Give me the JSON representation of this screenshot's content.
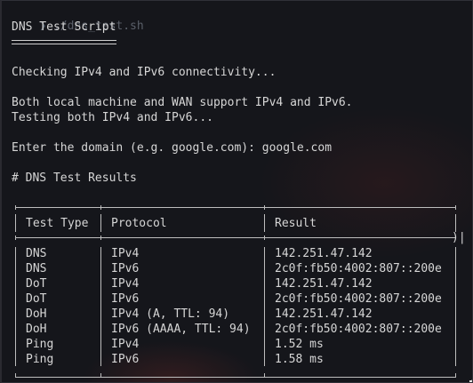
{
  "prompt": {
    "symbol": "❯",
    "command": "./dns_test.sh"
  },
  "heading": "DNS Test Script",
  "messages": {
    "checking": "Checking IPv4 and IPv6 connectivity...",
    "support": "Both local machine and WAN support IPv4 and IPv6.",
    "testing": "Testing both IPv4 and IPv6...",
    "enter_domain": "Enter the domain (e.g. google.com): google.com",
    "results_heading": "# DNS Test Results"
  },
  "table": {
    "headers": [
      "Test Type",
      "Protocol",
      "Result"
    ],
    "rows": [
      [
        "DNS",
        "IPv4",
        "142.251.47.142"
      ],
      [
        "DNS",
        "IPv6",
        "2c0f:fb50:4002:807::200e"
      ],
      [
        "DoT",
        "IPv4",
        "142.251.47.142"
      ],
      [
        "DoT",
        "IPv6",
        "2c0f:fb50:4002:807::200e"
      ],
      [
        "DoH",
        "IPv4 (A, TTL: 94)",
        "142.251.47.142"
      ],
      [
        "DoH",
        "IPv6 (AAAA, TTL: 94)",
        "2c0f:fb50:4002:807::200e"
      ],
      [
        "Ping",
        "IPv4",
        "1.52 ms"
      ],
      [
        "Ping",
        "IPv6",
        "1.58 ms"
      ]
    ],
    "header_trail": ")|"
  },
  "colors": {
    "background": "#15161b",
    "text": "#d6d6d6",
    "dim_command": "#5a5f69",
    "rule": "#bdbdbd"
  }
}
